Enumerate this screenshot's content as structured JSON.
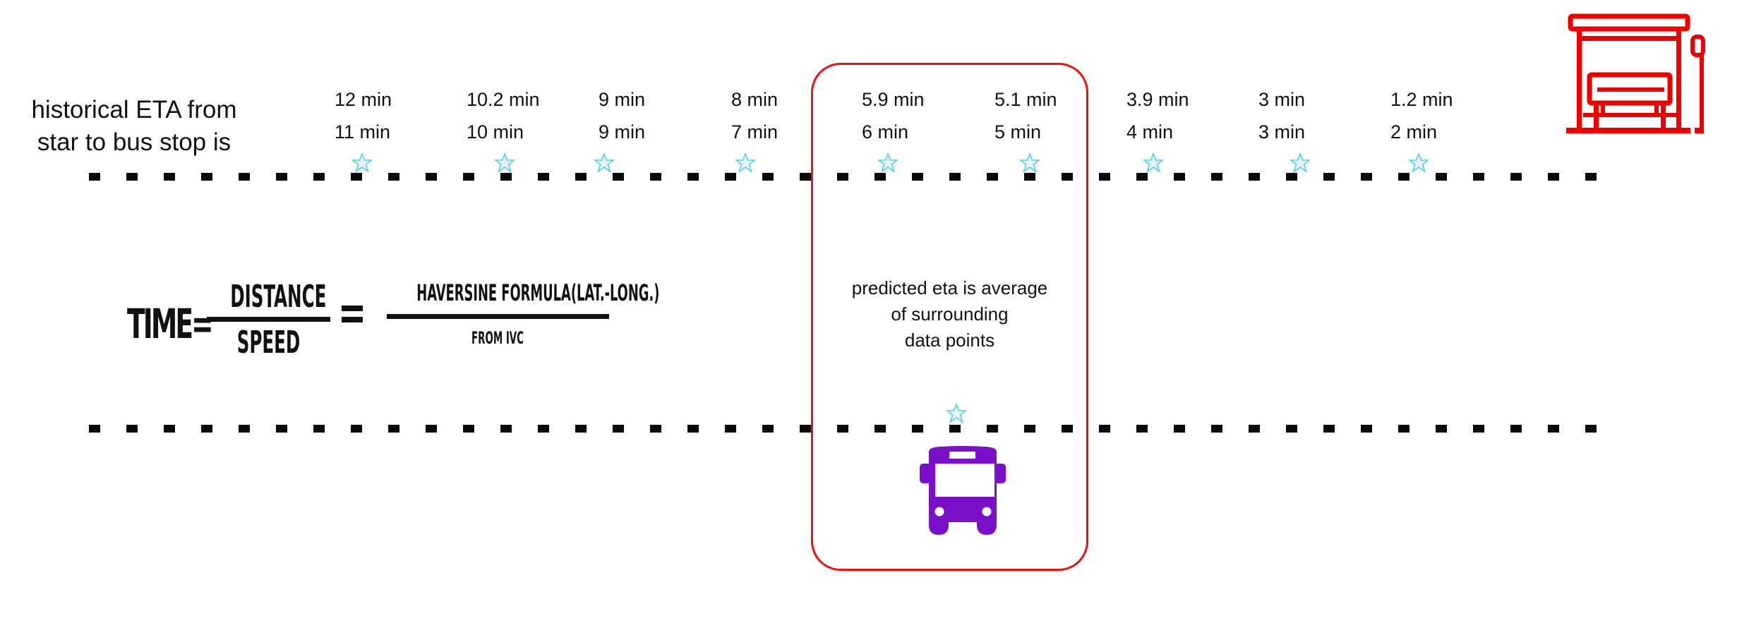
{
  "intro": {
    "line1": "historical ETA from",
    "line2": "star to bus stop is"
  },
  "eta_points": [
    {
      "top": "12 min",
      "bottom": "11 min"
    },
    {
      "top": "10.2 min",
      "bottom": "10 min"
    },
    {
      "top": "9 min",
      "bottom": "9 min"
    },
    {
      "top": "8 min",
      "bottom": "7 min"
    },
    {
      "top": "5.9 min",
      "bottom": "6 min"
    },
    {
      "top": "5.1 min",
      "bottom": "5 min"
    },
    {
      "top": "3.9 min",
      "bottom": "4 min"
    },
    {
      "top": "3 min",
      "bottom": "3 min"
    },
    {
      "top": "1.2 min",
      "bottom": "2 min"
    }
  ],
  "formula": {
    "lhs": "TIME=",
    "numerator": "DISTANCE",
    "denominator": "SPEED",
    "rhs_numerator": "HAVERSINE FORMULA(LAT.-LONG.)",
    "rhs_denominator": "FROM IVC"
  },
  "note": {
    "line1": "predicted eta is average",
    "line2": "of surrounding",
    "line3": "data points"
  },
  "icons": {
    "star": "star-icon",
    "bus": "bus-icon",
    "bus_stop": "bus-stop-icon"
  },
  "colors": {
    "highlight_box": "#ee1111",
    "bus": "#7a10c8",
    "bus_stop": "#ee0000",
    "star_stroke": "#4fd0f0",
    "star_fill": "#e8f2f2",
    "dash": "#0a0a0a"
  }
}
